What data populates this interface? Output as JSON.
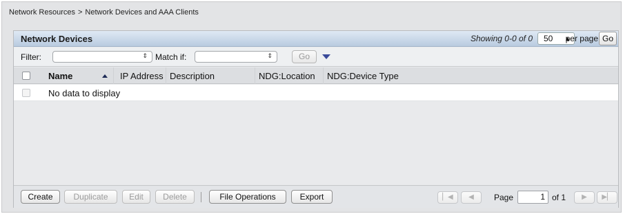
{
  "breadcrumb": [
    "Network Resources",
    "Network Devices and AAA Clients"
  ],
  "breadcrumb_sep": ">",
  "panel": {
    "title": "Network Devices",
    "showing": "Showing 0-0 of 0",
    "per_page_value": "50",
    "per_page_label": "per page",
    "go_label": "Go"
  },
  "filter": {
    "label": "Filter:",
    "filter_value": "",
    "match_label": "Match if:",
    "match_value": "",
    "go_label": "Go"
  },
  "table": {
    "columns": [
      "Name",
      "IP Address",
      "Description",
      "NDG:Location",
      "NDG:Device Type"
    ],
    "sort_column": "Name",
    "sort_direction": "ascending",
    "empty_text": "No data to display"
  },
  "footer": {
    "buttons": [
      {
        "label": "Create",
        "enabled": true
      },
      {
        "label": "Duplicate",
        "enabled": false
      },
      {
        "label": "Edit",
        "enabled": false
      },
      {
        "label": "Delete",
        "enabled": false
      },
      {
        "label": "File Operations",
        "enabled": true
      },
      {
        "label": "Export",
        "enabled": true
      }
    ],
    "page_label": "Page",
    "page_value": "1",
    "of_label": "of 1"
  },
  "icons": {
    "first": "first-page-icon",
    "prev": "previous-page-icon",
    "next": "next-page-icon",
    "last": "last-page-icon",
    "filter_menu": "dropdown-triangle-icon",
    "sort": "sort-ascending-icon"
  }
}
